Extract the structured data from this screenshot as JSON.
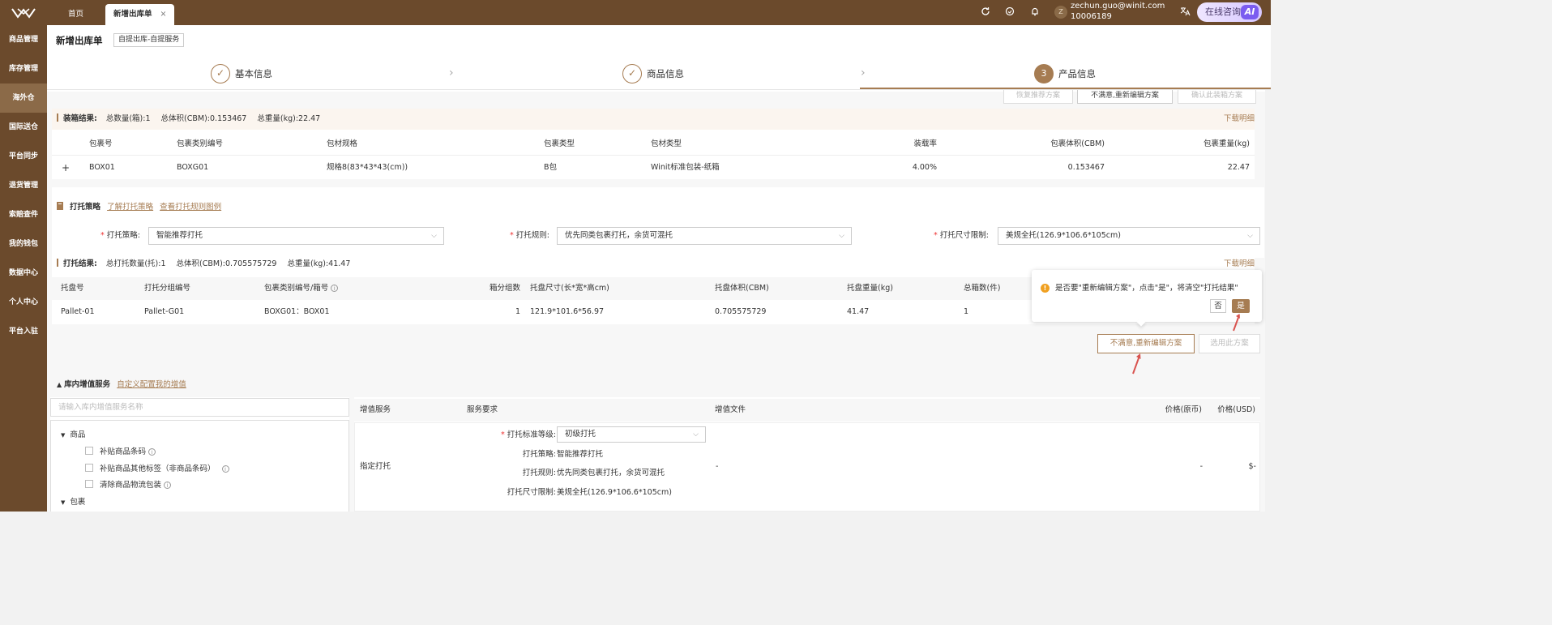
{
  "topbar": {
    "tabs": [
      {
        "label": "首页"
      },
      {
        "label": "新增出库单"
      }
    ],
    "close_glyph": "×",
    "user": {
      "avatar": "Z",
      "email": "zechun.guo@winit.com",
      "id": "10006189"
    },
    "consult_label": "在线咨询",
    "ai_label": "AI"
  },
  "sidebar": {
    "items": [
      {
        "label": "商品管理"
      },
      {
        "label": "库存管理"
      },
      {
        "label": "海外仓"
      },
      {
        "label": "国际送仓"
      },
      {
        "label": "平台同步"
      },
      {
        "label": "退货管理"
      },
      {
        "label": "索赔查件"
      },
      {
        "label": "我的钱包"
      },
      {
        "label": "数据中心"
      },
      {
        "label": "个人中心"
      },
      {
        "label": "平台入驻"
      }
    ]
  },
  "page": {
    "title": "新增出库单",
    "badge": "自提出库-自提服务"
  },
  "steps": [
    {
      "label": "基本信息",
      "marker": "✓"
    },
    {
      "label": "商品信息",
      "marker": "✓"
    },
    {
      "label": "产品信息",
      "marker": "3"
    }
  ],
  "ghost_buttons": [
    "恢复推荐方案",
    "不满意,重新编辑方案",
    "确认此装箱方案"
  ],
  "packing": {
    "title": "装箱结果:",
    "summary": [
      "总数量(箱):1",
      "总体积(CBM):0.153467",
      "总重量(kg):22.47"
    ],
    "download": "下载明细",
    "columns": [
      "包裹号",
      "包裹类别编号",
      "包材规格",
      "包裹类型",
      "包材类型",
      "装载率",
      "包裹体积(CBM)",
      "包裹重量(kg)"
    ],
    "rows": [
      {
        "expand": "+",
        "cells": [
          "BOX01",
          "BOXG01",
          "规格8(83*43*43(cm))",
          "B包",
          "Winit标准包装-纸箱",
          "4.00%",
          "0.153467",
          "22.47"
        ]
      }
    ]
  },
  "strategy": {
    "title": "打托策略",
    "links": [
      "了解打托策略",
      "查看打托规则图例"
    ],
    "fields": [
      {
        "label": "打托策略:",
        "value": "智能推荐打托"
      },
      {
        "label": "打托规则:",
        "value": "优先同类包裹打托，余货可混托"
      },
      {
        "label": "打托尺寸限制:",
        "value": "美规全托(126.9*106.6*105cm)"
      }
    ],
    "required_mark": "*"
  },
  "pallet": {
    "title": "打托结果:",
    "summary": [
      "总打托数量(托):1",
      "总体积(CBM):0.705575729",
      "总重量(kg):41.47"
    ],
    "download": "下载明细",
    "columns": [
      "托盘号",
      "打托分组编号",
      "包裹类别编号/箱号",
      "箱分组数",
      "托盘尺寸(长*宽*高cm)",
      "托盘体积(CBM)",
      "托盘重量(kg)",
      "总箱数(件)"
    ],
    "rows": [
      {
        "cells": [
          "Pallet-01",
          "Pallet-G01",
          "BOXG01：BOX01",
          "1",
          "121.9*101.6*56.97",
          "0.705575729",
          "41.47",
          "1"
        ]
      }
    ]
  },
  "popconfirm": {
    "message": "是否要\"重新编辑方案\"，点击\"是\"，将清空\"打托结果\"",
    "no": "否",
    "yes": "是"
  },
  "actions": {
    "reedit": "不满意,重新编辑方案",
    "use": "选用此方案"
  },
  "vas": {
    "title": "库内增值服务",
    "link": "自定义配置我的增值",
    "search_placeholder": "请输入库内增值服务名称",
    "tree": [
      {
        "group": "商品",
        "items": [
          "补贴商品条码",
          "补贴商品其他标签（非商品条码）",
          "清除商品物流包装"
        ]
      },
      {
        "group": "包裹",
        "items": []
      }
    ],
    "columns": [
      "增值服务",
      "服务要求",
      "增值文件",
      "价格(原币)",
      "价格(USD)"
    ],
    "row": {
      "service": "指定打托",
      "req_label": "打托标准等级:",
      "req_value": "初级打托",
      "details": [
        {
          "label": "打托策略:",
          "value": "智能推荐打托"
        },
        {
          "label": "打托规则:",
          "value": "优先同类包裹打托，余货可混托"
        },
        {
          "label": "打托尺寸限制:",
          "value": "美规全托(126.9*106.6*105cm)"
        }
      ],
      "file": "-",
      "price_orig": "-",
      "price_usd": "$-"
    }
  },
  "colors": {
    "brand": "#6b4a2c",
    "accent": "#a67c52",
    "arrow": "#d9534f"
  }
}
